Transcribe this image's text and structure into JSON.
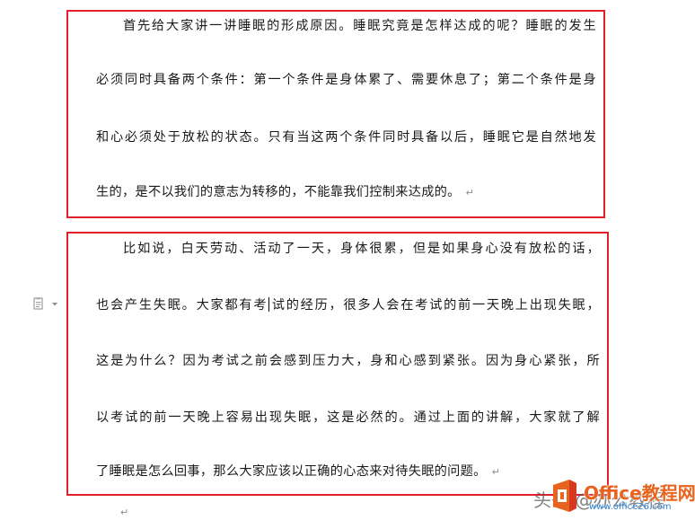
{
  "document": {
    "paragraphs": [
      {
        "lines": [
          "首先给大家讲一讲睡眠的形成原因。睡眠究竟是怎样达成的呢？睡眠的发生",
          "必须同时具备两个条件：第一个条件是身体累了、需要休息了；第二个条件是身",
          "和心必须处于放松的状态。只有当这两个条件同时具备以后，睡眠它是自然地发",
          "生的，是不以我们的意志为转移的，不能靠我们控制来达成的。"
        ]
      },
      {
        "lines": [
          "比如说，白天劳动、活动了一天，身体很累，但是如果身心没有放松的话，",
          "也会产生失眠。大家都有考",
          "试的经历，很多人会在考试的前一天晚上出现失眠，",
          "这是为什么？因为考试之前会感到压力大，身和心感到紧张。因为身心紧张，所",
          "以考试的前一天晚上容易出现失眠，这是必然的。通过上面的讲解，大家就了解",
          "了睡眠是怎么回事，那么大家应该以正确的心态来对待失眠的问题。"
        ]
      }
    ],
    "paragraph_mark": "↵",
    "empty_paragraph_mark": "↵"
  },
  "paste_options": {
    "icon": "paste-options-icon",
    "arrow": "▾"
  },
  "watermark": {
    "faded_text": "头条 @办公教程",
    "brand": "Office教程网",
    "url": "www.office26.com"
  },
  "colors": {
    "highlight_border": "#e0202a",
    "logo_orange": "#e8641e",
    "logo_red": "#d63a1e",
    "url_blue": "#2a7fd4",
    "paragraph_mark": "#8a8a8a"
  }
}
